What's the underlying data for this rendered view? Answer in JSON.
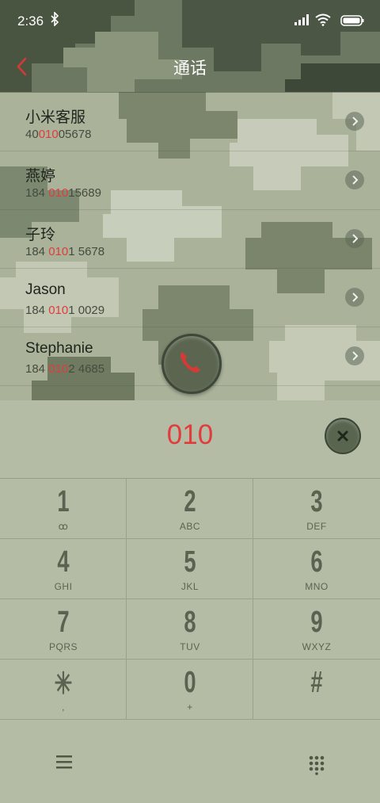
{
  "status_bar": {
    "time": "2:36",
    "icons": [
      "bluetooth-icon",
      "signal-icon",
      "wifi-icon",
      "battery-icon"
    ]
  },
  "header": {
    "title": "通话",
    "back_icon": "chevron-left-icon"
  },
  "results": [
    {
      "name": "小米客服",
      "number_parts": [
        "40",
        "010",
        "05678"
      ]
    },
    {
      "name": "燕婷",
      "number_parts": [
        "184 ",
        "010",
        "15689"
      ]
    },
    {
      "name": "子玲",
      "number_parts": [
        "184 ",
        "010",
        "1 5678"
      ]
    },
    {
      "name": "Jason",
      "number_parts": [
        "184 ",
        "010",
        "1 0029"
      ]
    },
    {
      "name": "Stephanie",
      "number_parts": [
        "184 ",
        "010",
        "2 4685"
      ]
    }
  ],
  "dialer": {
    "input": "010",
    "delete_icon": "backspace-icon",
    "keys": [
      {
        "digit": "1",
        "letters": "ꝏ"
      },
      {
        "digit": "2",
        "letters": "ABC"
      },
      {
        "digit": "3",
        "letters": "DEF"
      },
      {
        "digit": "4",
        "letters": "GHI"
      },
      {
        "digit": "5",
        "letters": "JKL"
      },
      {
        "digit": "6",
        "letters": "MNO"
      },
      {
        "digit": "7",
        "letters": "PQRS"
      },
      {
        "digit": "8",
        "letters": "TUV"
      },
      {
        "digit": "9",
        "letters": "WXYZ"
      },
      {
        "digit": "✳",
        "letters": ","
      },
      {
        "digit": "0",
        "letters": "+"
      },
      {
        "digit": "#",
        "letters": ""
      }
    ],
    "bottom_icons": [
      "menu-icon",
      "phone-icon",
      "keypad-icon"
    ]
  },
  "colors": {
    "accent": "#e23b3b",
    "key_text": "#5a6352",
    "camo_dark": "#3f4a3a",
    "camo_light": "#c3c9b6"
  }
}
